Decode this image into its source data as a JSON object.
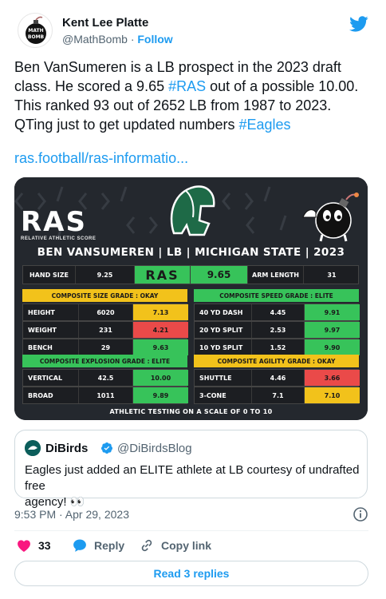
{
  "author": {
    "name": "Kent Lee Platte",
    "handle": "@MathBomb",
    "separator": "·",
    "follow_label": "Follow",
    "avatar_text": "MATH BOMB"
  },
  "tweet": {
    "line1": "Ben VanSumeren is a LB prospect in the 2023 draft",
    "line2_prefix": "class. He scored a 9.65 ",
    "line2_tag": "#RAS",
    "line2_suffix": " out of a possible 10.00.",
    "line3": "This ranked 93 out of 2652 LB from 1987 to 2023.",
    "line4_prefix": "QTing just to get updated numbers ",
    "line4_tag": "#Eagles",
    "link": "ras.football/ras-informatio..."
  },
  "ras_card": {
    "logo": "RAS",
    "logo_sub": "RELATIVE ATHLETIC SCORE",
    "banner": "BEN VANSUMEREN | LB | MICHIGAN STATE | 2023",
    "hand_size_label": "HAND SIZE",
    "hand_size": "9.25",
    "ras_label": "RAS",
    "ras_score": "9.65",
    "arm_length_label": "ARM LENGTH",
    "arm_length": "31",
    "grade_size": "COMPOSITE SIZE GRADE : OKAY",
    "grade_speed": "COMPOSITE SPEED GRADE : ELITE",
    "grade_explosion": "COMPOSITE EXPLOSION GRADE : ELITE",
    "grade_agility": "COMPOSITE AGILITY GRADE : OKAY",
    "rows": [
      {
        "l_label": "HEIGHT",
        "l_val": "6020",
        "l_score": "7.13",
        "l_color": "#f2c21b",
        "r_label": "40 YD DASH",
        "r_val": "4.45",
        "r_score": "9.91",
        "r_color": "#37c35a"
      },
      {
        "l_label": "WEIGHT",
        "l_val": "231",
        "l_score": "4.21",
        "l_color": "#ea4a49",
        "r_label": "20 YD SPLIT",
        "r_val": "2.53",
        "r_score": "9.97",
        "r_color": "#37c35a"
      },
      {
        "l_label": "BENCH",
        "l_val": "29",
        "l_score": "9.63",
        "l_color": "#37c35a",
        "r_label": "10 YD SPLIT",
        "r_val": "1.52",
        "r_score": "9.90",
        "r_color": "#37c35a"
      }
    ],
    "rows2": [
      {
        "l_label": "VERTICAL",
        "l_val": "42.5",
        "l_score": "10.00",
        "l_color": "#37c35a",
        "r_label": "SHUTTLE",
        "r_val": "4.46",
        "r_score": "3.66",
        "r_color": "#ea4a49"
      },
      {
        "l_label": "BROAD",
        "l_val": "1011",
        "l_score": "9.89",
        "l_color": "#37c35a",
        "r_label": "3-CONE",
        "r_val": "7.1",
        "r_score": "7.10",
        "r_color": "#f2c21b"
      }
    ],
    "footnote": "ATHLETIC TESTING ON A SCALE OF 0 TO 10"
  },
  "quote": {
    "name": "DiBirds",
    "handle": "@DiBirdsBlog",
    "line1": "Eagles just added an ELITE athlete at LB courtesy of undrafted free",
    "line2": "agency! 👀"
  },
  "meta": {
    "timestamp": "9:53 PM · Apr 29, 2023"
  },
  "actions": {
    "likes": "33",
    "reply_label": "Reply",
    "copy_label": "Copy link",
    "read_replies": "Read 3 replies"
  },
  "colors": {
    "twitter_blue": "#1d9bf0",
    "like_red": "#f91880",
    "grade_green": "#37c35a",
    "grade_yellow": "#f2c21b",
    "grade_red": "#ea4a49"
  }
}
